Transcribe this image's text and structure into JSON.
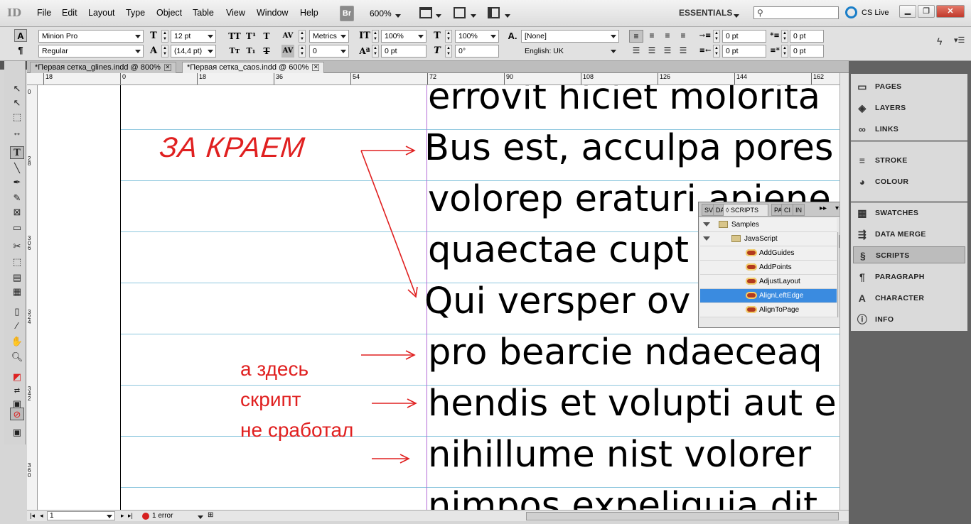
{
  "app": {
    "logo": "ID",
    "menu": [
      "File",
      "Edit",
      "Layout",
      "Type",
      "Object",
      "Table",
      "View",
      "Window",
      "Help"
    ],
    "bridge": "Br",
    "zoom": "600%",
    "workspace": "ESSENTIALS",
    "search_placeholder": "",
    "cslive": "CS Live"
  },
  "control": {
    "font_family": "Minion Pro",
    "font_style": "Regular",
    "font_size": "12 pt",
    "leading": "(14,4 pt)",
    "kerning": "Metrics",
    "tracking": "0",
    "vscale": "100%",
    "hscale": "100%",
    "baseline": "0 pt",
    "skew": "0°",
    "char_style": "[None]",
    "language": "English: UK",
    "indent_left": "0 pt",
    "indent_right": "0 pt",
    "indent_first": "0 pt",
    "indent_last": "0 pt",
    "space_before": "0 pt",
    "space_after": "0 pt",
    "tt": "TT",
    "tsup": "T¹",
    "tstrike": "T",
    "tsmall": "Tт",
    "tsub": "T₁",
    "tunder": "T"
  },
  "tabs": [
    {
      "label": "*Первая сетка_glines.indd @ 800%"
    },
    {
      "label": "*Первая сетка_caos.indd @ 600%"
    }
  ],
  "ruler": [
    "18",
    "0",
    "18",
    "36",
    "54",
    "72",
    "90",
    "108",
    "126",
    "144",
    "162"
  ],
  "vruler": [
    "0",
    "2 8",
    "3 0 6",
    "3 2 4",
    "3 4 2",
    "3 6 0"
  ],
  "canvas": {
    "lines": [
      "errovit hiciet molorita",
      "Bus est, acculpa pores",
      "volorep eraturi apiene",
      "quaectae cupt",
      "Qui versper ov",
      "pro bearcie ndaeceaq",
      "hendis et volupti aut e",
      "nihillume nist volorer",
      "nimpos expeliquia dit"
    ],
    "annot_top": "ЗА КРАЕМ",
    "annot_1": "а здесь",
    "annot_2": "скрипт",
    "annot_3": "не сработал"
  },
  "scripts_panel": {
    "tabs": [
      "SV",
      "DA",
      "SCRIPTS",
      "PA",
      "CI",
      "IN"
    ],
    "rows": [
      {
        "label": "Samples",
        "kind": "folder",
        "level": 0
      },
      {
        "label": "JavaScript",
        "kind": "folder",
        "level": 1
      },
      {
        "label": "AddGuides",
        "kind": "script",
        "level": 2
      },
      {
        "label": "AddPoints",
        "kind": "script",
        "level": 2
      },
      {
        "label": "AdjustLayout",
        "kind": "script",
        "level": 2
      },
      {
        "label": "AlignLeftEdge",
        "kind": "script",
        "level": 2,
        "selected": true
      },
      {
        "label": "AlignToPage",
        "kind": "script",
        "level": 2
      }
    ]
  },
  "right_panel": [
    {
      "label": "PAGES",
      "icon": "pages-icon"
    },
    {
      "label": "LAYERS",
      "icon": "layers-icon"
    },
    {
      "label": "LINKS",
      "icon": "links-icon"
    },
    {
      "label": "STROKE",
      "icon": "stroke-icon"
    },
    {
      "label": "COLOUR",
      "icon": "colour-icon"
    },
    {
      "label": "SWATCHES",
      "icon": "swatches-icon"
    },
    {
      "label": "DATA MERGE",
      "icon": "data-merge-icon"
    },
    {
      "label": "SCRIPTS",
      "icon": "scripts-icon",
      "active": true
    },
    {
      "label": "PARAGRAPH",
      "icon": "paragraph-icon"
    },
    {
      "label": "CHARACTER",
      "icon": "character-icon"
    },
    {
      "label": "INFO",
      "icon": "info-icon"
    }
  ],
  "status": {
    "page": "1",
    "errors": "1 error"
  },
  "colors": {
    "annotation": "#e02020",
    "baseline_grid": "#8dc7de",
    "margin_guide": "#b36bd6",
    "selection": "#3a8be0"
  }
}
